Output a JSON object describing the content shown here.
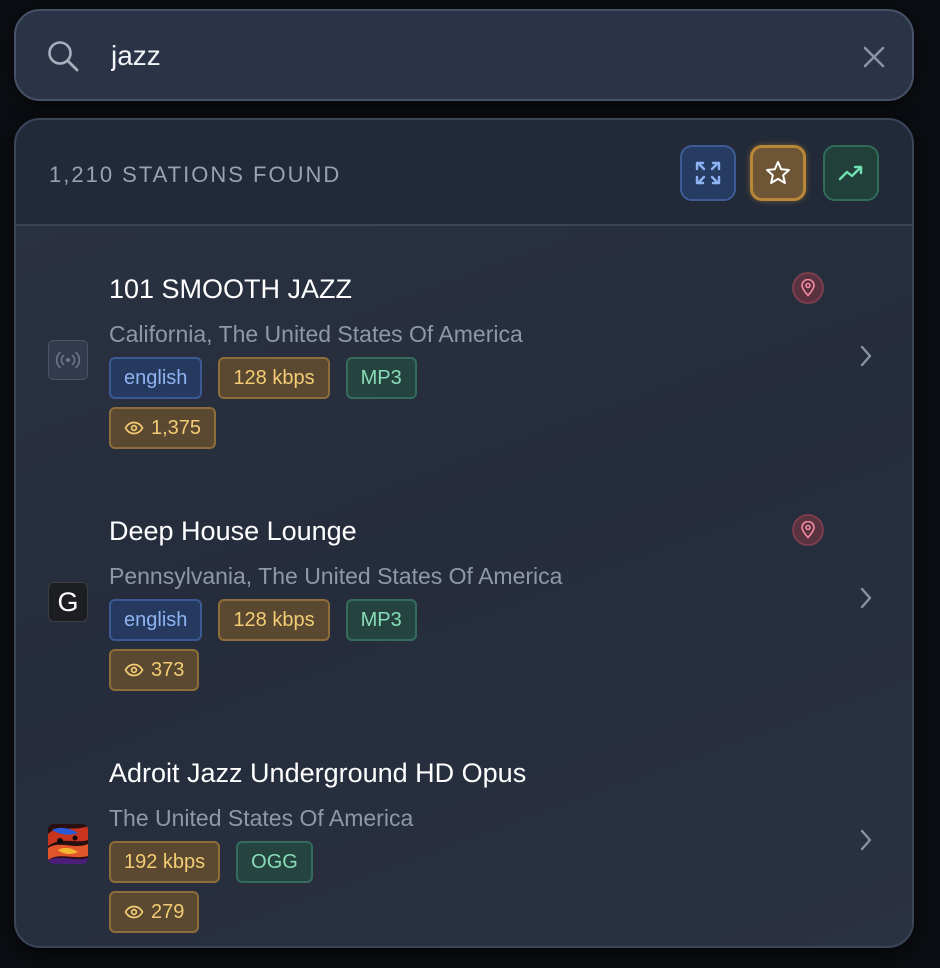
{
  "search": {
    "value": "jazz",
    "search_icon": "search-icon",
    "clear_icon": "close-icon"
  },
  "results": {
    "count_label": "1,210 STATIONS FOUND",
    "buttons": [
      {
        "name": "expand",
        "icon": "expand-icon"
      },
      {
        "name": "favorites",
        "icon": "star-icon",
        "active": true
      },
      {
        "name": "trending",
        "icon": "trending-up-icon"
      }
    ]
  },
  "stations": [
    {
      "name": "101 SMOOTH JAZZ",
      "location": "California, The United States Of America",
      "language": "english",
      "bitrate": "128 kbps",
      "codec": "MP3",
      "views": "1,375",
      "logo": "radio-waves-icon",
      "pin_icon": "location-pin-icon"
    },
    {
      "name": "Deep House Lounge",
      "location": "Pennsylvania, The United States Of America",
      "language": "english",
      "bitrate": "128 kbps",
      "codec": "MP3",
      "views": "373",
      "logo": "G",
      "pin_icon": "location-pin-icon"
    },
    {
      "name": "Adroit Jazz Underground HD Opus",
      "location": "The United States Of America",
      "bitrate": "192 kbps",
      "codec": "OGG",
      "views": "279",
      "logo": "abstract-art-thumbnail"
    }
  ],
  "colors": {
    "accent_blue": "#3e5c93",
    "accent_gold": "#b98738",
    "accent_green": "#346b5c",
    "pin_red": "#7a3e4e"
  }
}
